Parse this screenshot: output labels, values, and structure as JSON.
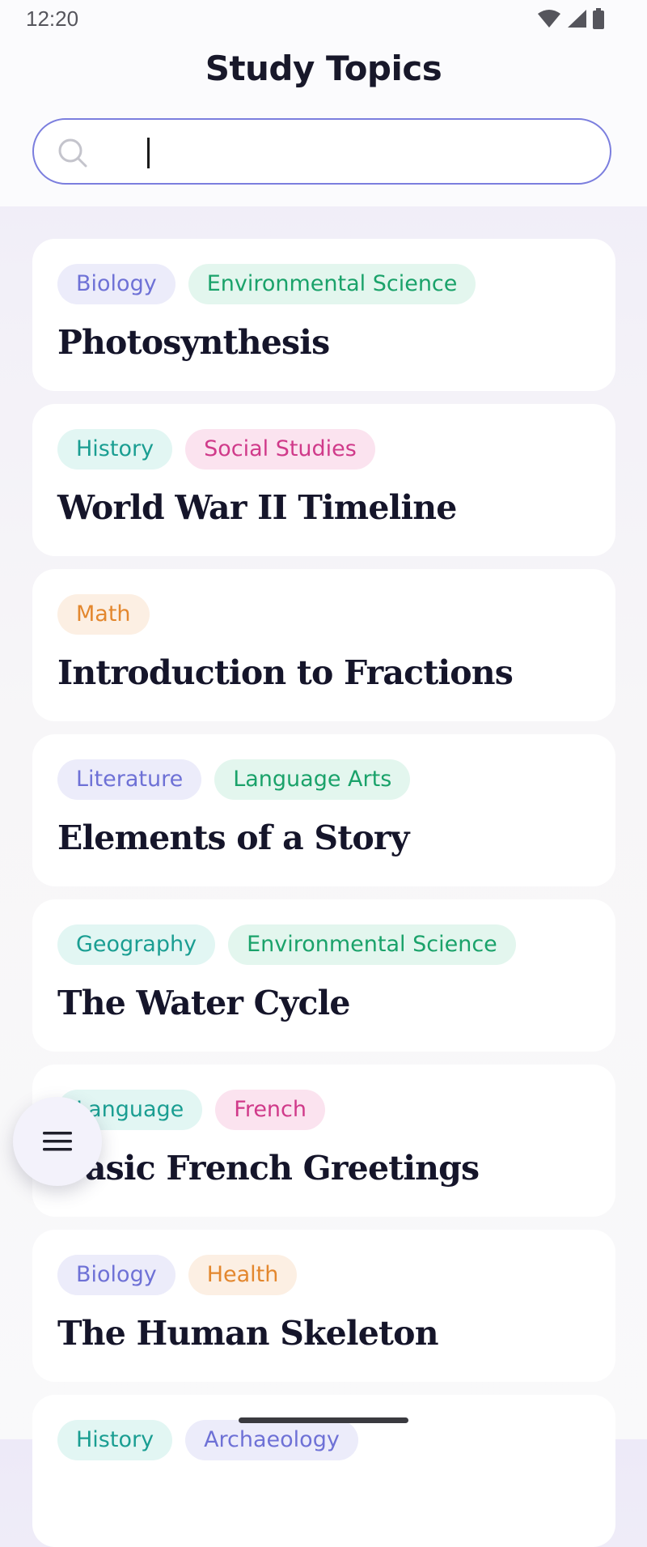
{
  "status_bar": {
    "time": "12:20",
    "icons": [
      "wifi-icon",
      "cellular-signal-icon",
      "battery-icon"
    ]
  },
  "header": {
    "title": "Study Topics"
  },
  "search": {
    "value": "",
    "placeholder": "",
    "icon": "search-icon"
  },
  "topics": [
    {
      "title": "Photosynthesis",
      "tags": [
        {
          "label": "Biology",
          "color": "indigo"
        },
        {
          "label": "Environmental Science",
          "color": "green"
        }
      ]
    },
    {
      "title": "World War II Timeline",
      "tags": [
        {
          "label": "History",
          "color": "teal"
        },
        {
          "label": "Social Studies",
          "color": "pink"
        }
      ]
    },
    {
      "title": "Introduction to Fractions",
      "tags": [
        {
          "label": "Math",
          "color": "orange"
        }
      ]
    },
    {
      "title": "Elements of a Story",
      "tags": [
        {
          "label": "Literature",
          "color": "indigo"
        },
        {
          "label": "Language Arts",
          "color": "green"
        }
      ]
    },
    {
      "title": "The Water Cycle",
      "tags": [
        {
          "label": "Geography",
          "color": "teal"
        },
        {
          "label": "Environmental Science",
          "color": "green"
        }
      ]
    },
    {
      "title": "Basic French Greetings",
      "tags": [
        {
          "label": "Language",
          "color": "teal"
        },
        {
          "label": "French",
          "color": "pink"
        }
      ]
    },
    {
      "title": "The Human Skeleton",
      "tags": [
        {
          "label": "Biology",
          "color": "indigo"
        },
        {
          "label": "Health",
          "color": "orange"
        }
      ]
    },
    {
      "title": "",
      "tags": [
        {
          "label": "History",
          "color": "teal"
        },
        {
          "label": "Archaeology",
          "color": "indigo"
        }
      ]
    }
  ],
  "fab": {
    "icon": "menu-icon"
  },
  "colors": {
    "search_border": "#7b7ede",
    "title_text": "#15152a",
    "tag_indigo": "#6e71d6",
    "tag_green": "#1aa26a",
    "tag_teal": "#1a9e92",
    "tag_pink": "#d03a8a",
    "tag_orange": "#e3872e"
  }
}
